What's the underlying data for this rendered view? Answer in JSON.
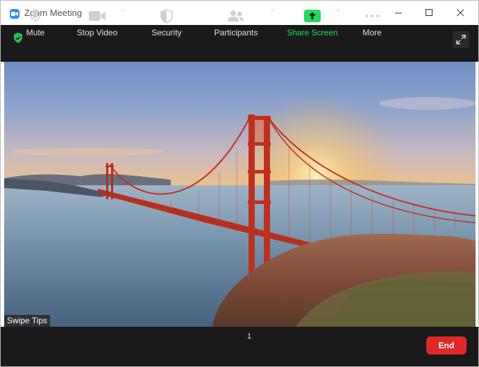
{
  "window": {
    "title": "Zoom Meeting"
  },
  "video": {
    "overlay_label": "Swipe Tips"
  },
  "toolbar": {
    "mute_label": "Mute",
    "stop_video_label": "Stop Video",
    "security_label": "Security",
    "participants_label": "Participants",
    "participants_count": "1",
    "share_screen_label": "Share Screen",
    "more_label": "More",
    "end_label": "End"
  },
  "colors": {
    "share_green": "#23d959",
    "end_red": "#e02828",
    "zoom_blue": "#2D8CFF",
    "toolbar_bg": "#1a1a1a"
  },
  "icons": [
    "zoom-app-icon",
    "minimize-icon",
    "maximize-icon",
    "close-icon",
    "security-shield-icon",
    "fullscreen-icon",
    "microphone-icon",
    "video-camera-icon",
    "shield-icon",
    "participants-icon",
    "share-screen-icon",
    "more-dots-icon",
    "caret-up-icon"
  ]
}
